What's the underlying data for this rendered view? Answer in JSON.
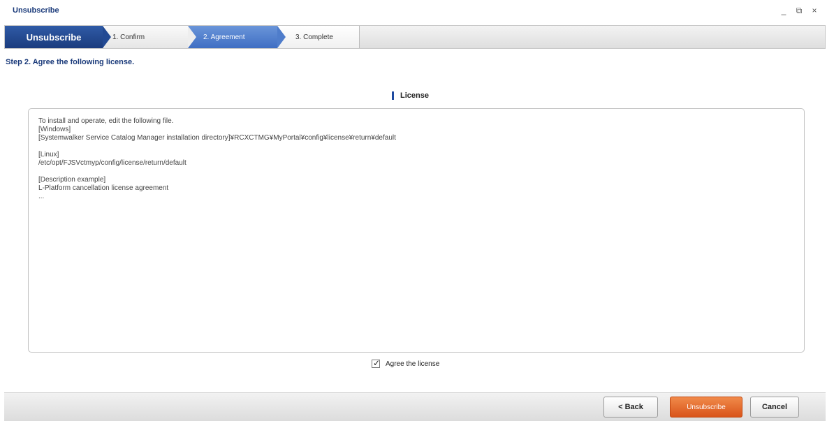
{
  "window": {
    "title": "Unsubscribe",
    "controls": [
      "_",
      "⧉",
      "×"
    ]
  },
  "steps": {
    "main": "Unsubscribe",
    "items": [
      "1. Confirm",
      "2. Agreement",
      "3. Complete"
    ],
    "active_index": 1
  },
  "heading": "Step 2. Agree the following license.",
  "section_title": "License",
  "license_lines": [
    "To install and operate, edit the following file.",
    "[Windows]",
    "[Systemwalker Service Catalog Manager installation directory]¥RCXCTMG¥MyPortal¥config¥license¥return¥default",
    "",
    "[Linux]",
    "/etc/opt/FJSVctmyp/config/license/return/default",
    "",
    "[Description example]",
    "L-Platform cancellation license agreement",
    "..."
  ],
  "agree": {
    "label": "Agree the license",
    "checked": true
  },
  "buttons": {
    "back": "< Back",
    "unsubscribe": "Unsubscribe",
    "cancel": "Cancel"
  }
}
